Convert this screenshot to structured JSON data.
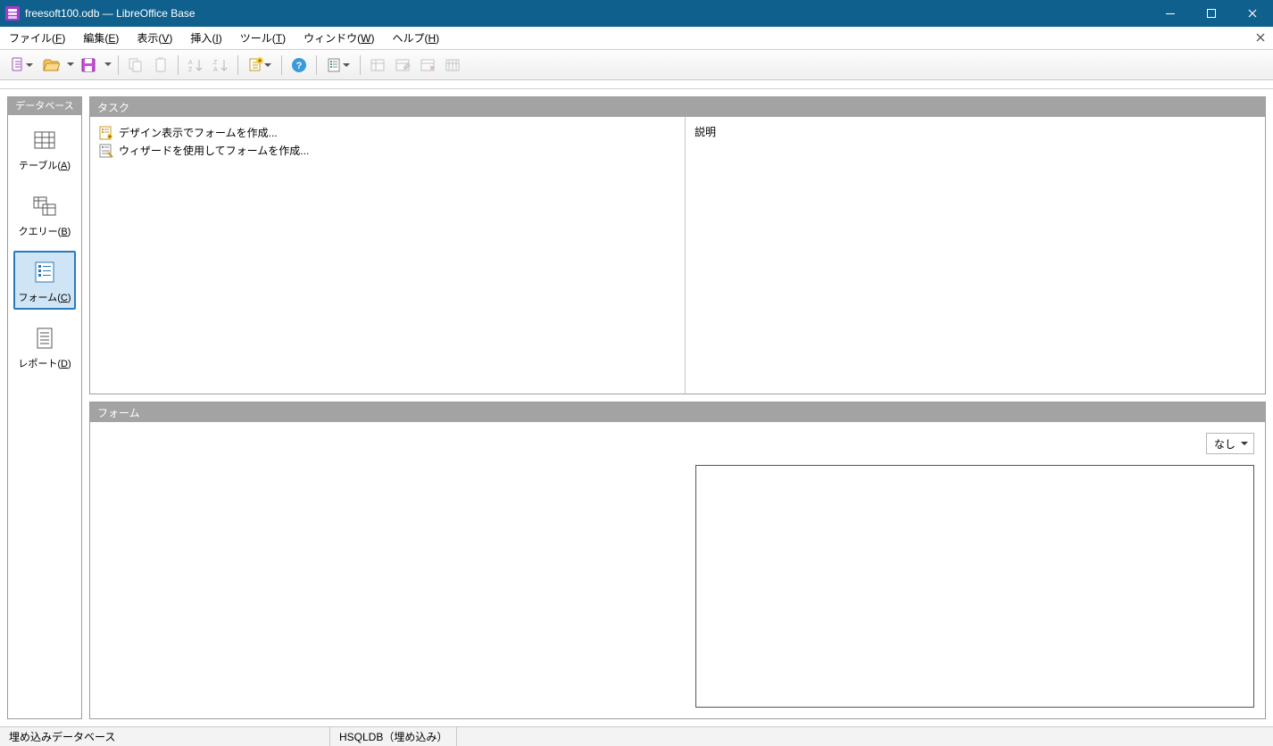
{
  "window": {
    "title": "freesoft100.odb — LibreOffice Base"
  },
  "menu": {
    "file": {
      "label": "ファイル",
      "accel": "F"
    },
    "edit": {
      "label": "編集",
      "accel": "E"
    },
    "view": {
      "label": "表示",
      "accel": "V"
    },
    "insert": {
      "label": "挿入",
      "accel": "I"
    },
    "tools": {
      "label": "ツール",
      "accel": "T"
    },
    "window": {
      "label": "ウィンドウ",
      "accel": "W"
    },
    "help": {
      "label": "ヘルプ",
      "accel": "H"
    }
  },
  "sidebar": {
    "header": "データベース",
    "tables": {
      "label": "テーブル",
      "accel": "A"
    },
    "queries": {
      "label": "クエリー",
      "accel": "B"
    },
    "forms": {
      "label": "フォーム",
      "accel": "C"
    },
    "reports": {
      "label": "レポート",
      "accel": "D"
    }
  },
  "panels": {
    "tasks": {
      "title": "タスク",
      "description_label": "説明",
      "items": [
        "デザイン表示でフォームを作成...",
        "ウィザードを使用してフォームを作成..."
      ]
    },
    "forms": {
      "title": "フォーム",
      "view_select": "なし"
    }
  },
  "statusbar": {
    "left": "埋め込みデータベース",
    "db": "HSQLDB（埋め込み）"
  }
}
